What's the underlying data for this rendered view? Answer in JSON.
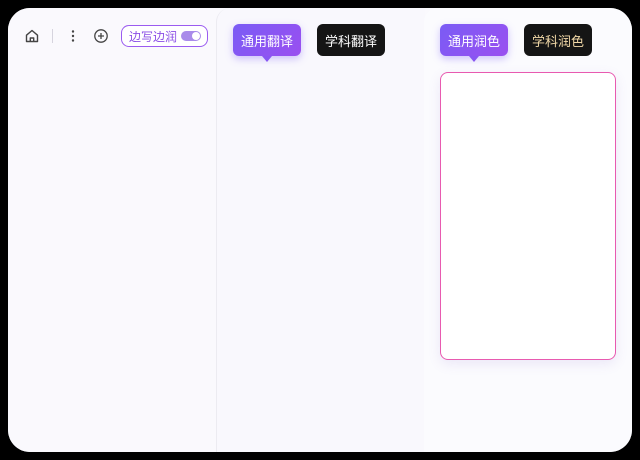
{
  "toolbar": {
    "home_icon": "home-icon",
    "more_icon": "more-vertical-icon",
    "add_icon": "plus-circle-icon",
    "pill_label": "边写边润",
    "pill_toggle_on": true
  },
  "translate_panel": {
    "tabs": [
      {
        "label": "通用翻译",
        "active": true
      },
      {
        "label": "学科翻译",
        "active": false
      }
    ]
  },
  "polish_panel": {
    "tabs": [
      {
        "label": "通用润色",
        "active": true
      },
      {
        "label": "学科润色",
        "active": false
      }
    ]
  },
  "colors": {
    "accent_start": "#7a5cf5",
    "accent_end": "#9a4ff0",
    "editor_border": "#e85ab0",
    "dark_tab": "#151515",
    "gold_text": "#f2d9a8"
  }
}
